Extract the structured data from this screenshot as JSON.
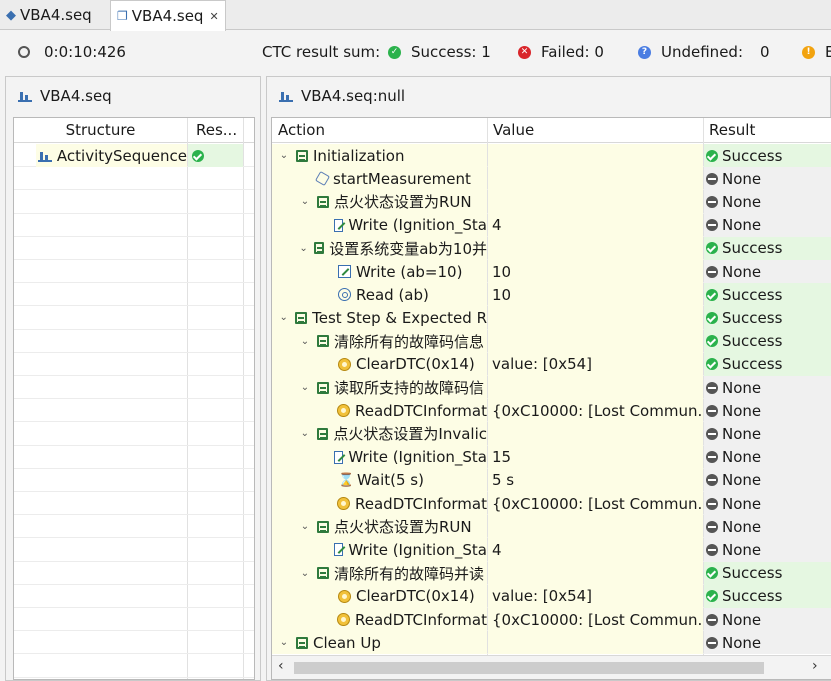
{
  "tabs": [
    {
      "label": "VBA4.seq"
    },
    {
      "label": "VBA4.seq"
    }
  ],
  "status": {
    "time": "0:0:10:426",
    "ctc_label": "CTC result sum:",
    "success": "Success: 1",
    "failed": "Failed: 0",
    "undefined_label": "Undefined:",
    "undefined_value": "0",
    "extra": "E"
  },
  "left_panel": {
    "title": "VBA4.seq",
    "col_structure": "Structure",
    "col_result": "Res...",
    "root": "ActivitySequence"
  },
  "right_panel": {
    "title": "VBA4.seq:null",
    "col_action": "Action",
    "col_value": "Value",
    "col_result": "Result",
    "rows": [
      {
        "action": "Initialization",
        "value": "",
        "result": "Success"
      },
      {
        "action": "startMeasurement",
        "value": "",
        "result": "None"
      },
      {
        "action": "点火状态设置为RUN",
        "value": "",
        "result": "None"
      },
      {
        "action": "Write (Ignition_Sta",
        "value": "4",
        "result": "None"
      },
      {
        "action": "设置系统变量ab为10并",
        "value": "",
        "result": "Success"
      },
      {
        "action": "Write (ab=10)",
        "value": "10",
        "result": "None"
      },
      {
        "action": "Read (ab)",
        "value": "10",
        "result": "Success"
      },
      {
        "action": "Test Step & Expected R",
        "value": "",
        "result": "Success"
      },
      {
        "action": "清除所有的故障码信息",
        "value": "",
        "result": "Success"
      },
      {
        "action": "ClearDTC(0x14)",
        "value": "value: [0x54]",
        "result": "Success"
      },
      {
        "action": "读取所支持的故障码信",
        "value": "",
        "result": "None"
      },
      {
        "action": "ReadDTCInformat",
        "value": "{0xC10000: [Lost Commun...",
        "result": "None"
      },
      {
        "action": "点火状态设置为Invalic",
        "value": "",
        "result": "None"
      },
      {
        "action": "Write (Ignition_Sta",
        "value": "15",
        "result": "None"
      },
      {
        "action": "Wait(5 s)",
        "value": "5 s",
        "result": "None"
      },
      {
        "action": "ReadDTCInformat",
        "value": "{0xC10000: [Lost Commun...",
        "result": "None"
      },
      {
        "action": "点火状态设置为RUN",
        "value": "",
        "result": "None"
      },
      {
        "action": "Write (Ignition_Sta",
        "value": "4",
        "result": "None"
      },
      {
        "action": "清除所有的故障码并读",
        "value": "",
        "result": "Success"
      },
      {
        "action": "ClearDTC(0x14)",
        "value": "value: [0x54]",
        "result": "Success"
      },
      {
        "action": "ReadDTCInformat",
        "value": "{0xC10000: [Lost Commun...",
        "result": "None"
      },
      {
        "action": "Clean Up",
        "value": "",
        "result": "None"
      }
    ]
  },
  "colors": {
    "yellow_row": "#fdfde5",
    "success_row": "#e5f7e1",
    "none_row": "#f0f0f0",
    "success": "#2bb24c",
    "failed": "#d9252a",
    "undefined": "#4a7de2"
  }
}
